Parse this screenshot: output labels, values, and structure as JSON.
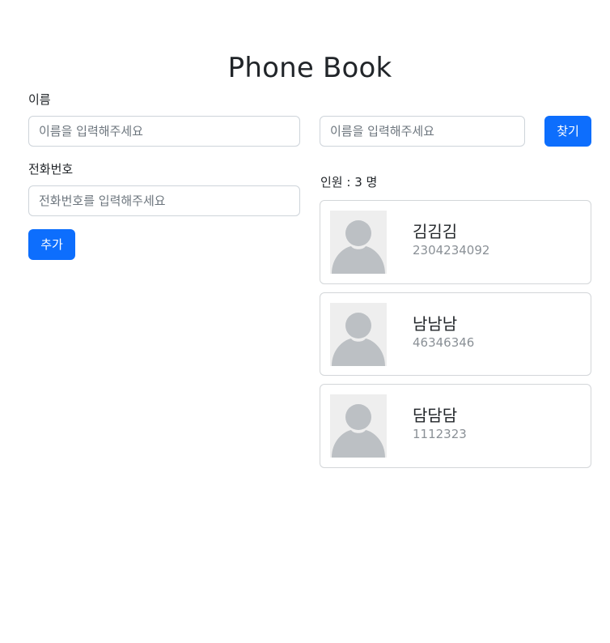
{
  "page": {
    "title": "Phone Book"
  },
  "form": {
    "name_label": "이름",
    "name_placeholder": "이름을 입력해주세요",
    "name_value": "",
    "phone_label": "전화번호",
    "phone_placeholder": "전화번호를 입력해주세요",
    "phone_value": "",
    "add_button": "추가"
  },
  "search": {
    "placeholder": "이름을 입력해주세요",
    "value": "",
    "button": "찾기"
  },
  "summary": {
    "prefix": "인원 : ",
    "count": "3",
    "suffix": " 명"
  },
  "contacts": [
    {
      "name": "김김김",
      "phone": "2304234092",
      "avatar_icon": "person-placeholder-icon"
    },
    {
      "name": "남남남",
      "phone": "46346346",
      "avatar_icon": "person-placeholder-icon"
    },
    {
      "name": "담담담",
      "phone": "1112323",
      "avatar_icon": "person-placeholder-icon"
    }
  ],
  "colors": {
    "primary": "#0d6efd",
    "border": "#ced4da",
    "avatar_bg": "#eeeeee",
    "avatar_figure": "#bcc0c4",
    "muted_text": "#8a9096"
  }
}
